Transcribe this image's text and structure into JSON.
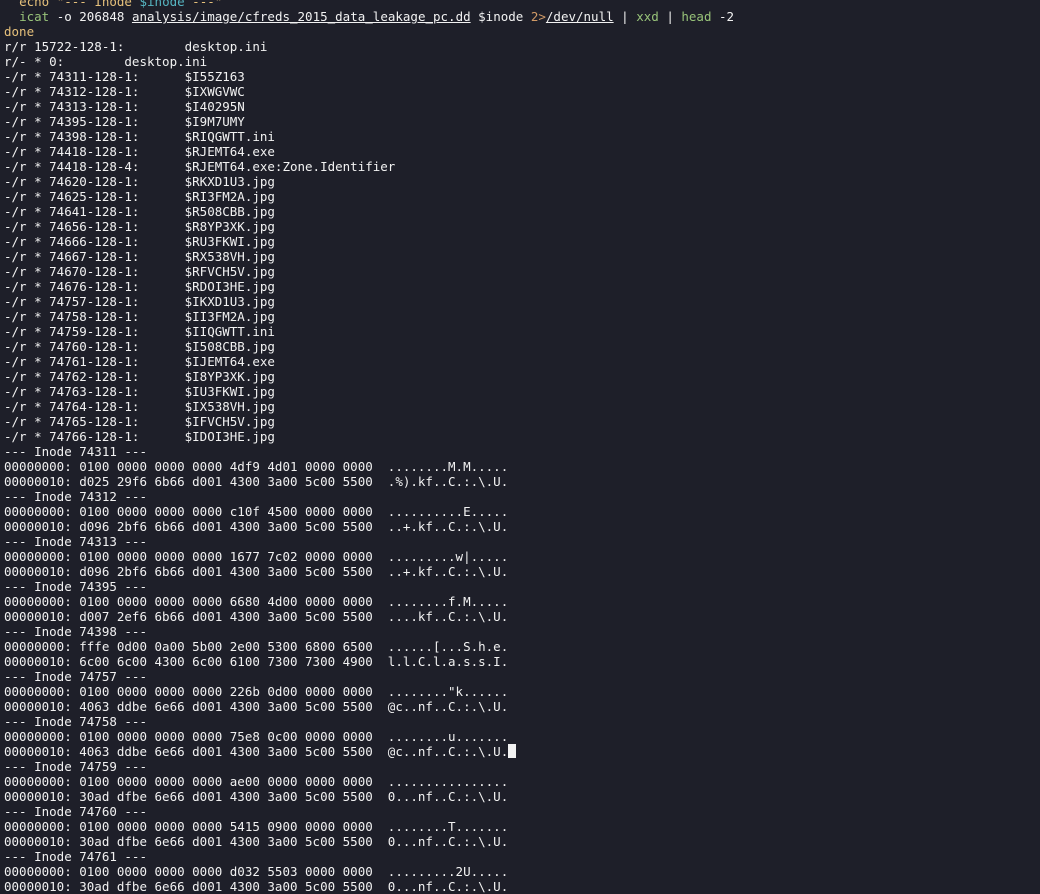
{
  "colors": {
    "background": "#1e1f29",
    "foreground": "#f2f2f2",
    "command": "#e5c07b",
    "variable": "#56b6c2",
    "builtin": "#98c379",
    "redirect": "#d19a66"
  },
  "command": {
    "echo_line": {
      "kw_echo": "echo",
      "str_open": "\"--- Inode ",
      "var_inode": "$inode",
      "str_close": " ---\""
    },
    "icat_line": {
      "indent": "  ",
      "cmd": "icat",
      "args": " -o 206848 ",
      "path": "analysis/image/cfreds_2015_data_leakage_pc.dd",
      "var": " $inode ",
      "redirect": "2>",
      "devnull": "/dev/null",
      "pipe1": " | ",
      "xxd": "xxd",
      "pipe2": " | ",
      "head": "head",
      "head_arg": " -2"
    },
    "done": "done"
  },
  "listing": [
    "r/r 15722-128-1:        desktop.ini",
    "r/- * 0:        desktop.ini",
    "-/r * 74311-128-1:      $I55Z163",
    "-/r * 74312-128-1:      $IXWGVWC",
    "-/r * 74313-128-1:      $I40295N",
    "-/r * 74395-128-1:      $I9M7UMY",
    "-/r * 74398-128-1:      $RIQGWTT.ini",
    "-/r * 74418-128-1:      $RJEMT64.exe",
    "-/r * 74418-128-4:      $RJEMT64.exe:Zone.Identifier",
    "-/r * 74620-128-1:      $RKXD1U3.jpg",
    "-/r * 74625-128-1:      $RI3FM2A.jpg",
    "-/r * 74641-128-1:      $R508CBB.jpg",
    "-/r * 74656-128-1:      $R8YP3XK.jpg",
    "-/r * 74666-128-1:      $RU3FKWI.jpg",
    "-/r * 74667-128-1:      $RX538VH.jpg",
    "-/r * 74670-128-1:      $RFVCH5V.jpg",
    "-/r * 74676-128-1:      $RDOI3HE.jpg",
    "-/r * 74757-128-1:      $IKXD1U3.jpg",
    "-/r * 74758-128-1:      $II3FM2A.jpg",
    "-/r * 74759-128-1:      $IIQGWTT.ini",
    "-/r * 74760-128-1:      $I508CBB.jpg",
    "-/r * 74761-128-1:      $IJEMT64.exe",
    "-/r * 74762-128-1:      $I8YP3XK.jpg",
    "-/r * 74763-128-1:      $IU3FKWI.jpg",
    "-/r * 74764-128-1:      $IX538VH.jpg",
    "-/r * 74765-128-1:      $IFVCH5V.jpg",
    "-/r * 74766-128-1:      $IDOI3HE.jpg"
  ],
  "hexdump": [
    "--- Inode 74311 ---",
    "00000000: 0100 0000 0000 0000 4df9 4d01 0000 0000  ........M.M.....",
    "00000010: d025 29f6 6b66 d001 4300 3a00 5c00 5500  .%).kf..C.:.\\.U.",
    "--- Inode 74312 ---",
    "00000000: 0100 0000 0000 0000 c10f 4500 0000 0000  ..........E.....",
    "00000010: d096 2bf6 6b66 d001 4300 3a00 5c00 5500  ..+.kf..C.:.\\.U.",
    "--- Inode 74313 ---",
    "00000000: 0100 0000 0000 0000 1677 7c02 0000 0000  .........w|.....",
    "00000010: d096 2bf6 6b66 d001 4300 3a00 5c00 5500  ..+.kf..C.:.\\.U.",
    "--- Inode 74395 ---",
    "00000000: 0100 0000 0000 0000 6680 4d00 0000 0000  ........f.M.....",
    "00000010: d007 2ef6 6b66 d001 4300 3a00 5c00 5500  ....kf..C.:.\\.U.",
    "--- Inode 74398 ---",
    "00000000: fffe 0d00 0a00 5b00 2e00 5300 6800 6500  ......[...S.h.e.",
    "00000010: 6c00 6c00 4300 6c00 6100 7300 7300 4900  l.l.C.l.a.s.s.I.",
    "--- Inode 74757 ---",
    "00000000: 0100 0000 0000 0000 226b 0d00 0000 0000  ........\"k......",
    "00000010: 4063 ddbe 6e66 d001 4300 3a00 5c00 5500  @c..nf..C.:.\\.U.",
    "--- Inode 74758 ---",
    "00000000: 0100 0000 0000 0000 75e8 0c00 0000 0000  ........u.......",
    "00000010: 4063 ddbe 6e66 d001 4300 3a00 5c00 5500  @c..nf..C.:.\\.U.",
    "--- Inode 74759 ---",
    "00000000: 0100 0000 0000 0000 ae00 0000 0000 0000  ................",
    "00000010: 30ad dfbe 6e66 d001 4300 3a00 5c00 5500  0...nf..C.:.\\.U.",
    "--- Inode 74760 ---",
    "00000000: 0100 0000 0000 0000 5415 0900 0000 0000  ........T.......",
    "00000010: 30ad dfbe 6e66 d001 4300 3a00 5c00 5500  0...nf..C.:.\\.U.",
    "--- Inode 74761 ---",
    "00000000: 0100 0000 0000 0000 d032 5503 0000 0000  .........2U.....",
    "00000010: 30ad dfbe 6e66 d001 4300 3a00 5c00 5500  0...nf..C.:.\\.U."
  ]
}
